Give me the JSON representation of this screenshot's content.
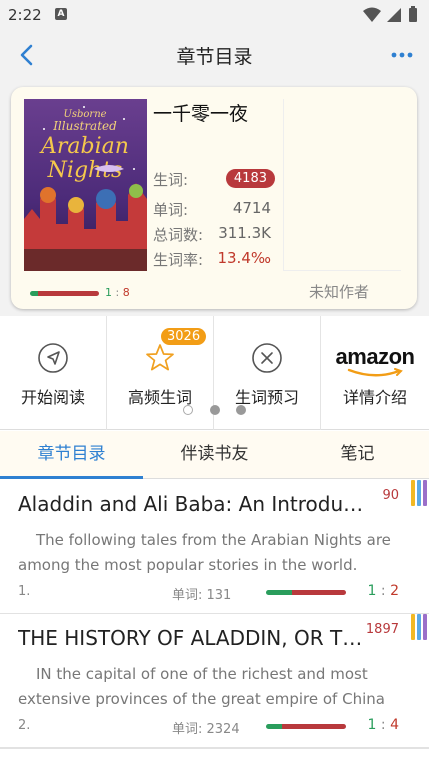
{
  "status_bar": {
    "time": "2:22",
    "notification_icon": "A"
  },
  "header": {
    "title": "章节目录",
    "back_icon": "chevron-left-icon",
    "more_icon": "more-dots-icon",
    "accent": "#2f80d1"
  },
  "book": {
    "title": "一千零一夜",
    "cover": {
      "publisher": "Usborne",
      "series": "Illustrated",
      "line1": "Arabian",
      "line2": "Nights"
    },
    "new_words_label": "生词:",
    "new_words_value": "4183",
    "words_label": "单词:",
    "words_value": "4714",
    "total_words_label": "总词数:",
    "total_words_value": "311.3K",
    "rate_label": "生词率:",
    "rate_value": "13.4‰",
    "author": "未知作者",
    "ratio_left": "1",
    "ratio_sep": " : ",
    "ratio_right": "8",
    "progress_known": 0.11
  },
  "actions": [
    {
      "label": "开始阅读",
      "icon": "navigation-arrow-icon"
    },
    {
      "label": "高频生词",
      "icon": "star-icon",
      "badge": "3026"
    },
    {
      "label": "生词预习",
      "icon": "close-circle-icon"
    },
    {
      "label": "详情介绍",
      "icon": "amazon-logo",
      "logo_text": "amazon"
    }
  ],
  "pager": {
    "count": 3,
    "active": 2
  },
  "tabs": [
    {
      "label": "章节目录",
      "active": true
    },
    {
      "label": "伴读书友",
      "active": false
    },
    {
      "label": "笔记",
      "active": false
    }
  ],
  "chapters": [
    {
      "title": "Aladdin and Ali Baba: An Introductory Note",
      "new_words": "90",
      "desc": "The following tales from the Arabian Nights are among the most popular stories in the world.",
      "index": "1.",
      "words": "单词: 131",
      "ratio_left": "1",
      "ratio_right": "2",
      "progress_known": 0.33
    },
    {
      "title": "THE HISTORY OF ALADDIN, OR THE WONDERFUL LAMP",
      "new_words": "1897",
      "desc": "IN the capital of one of the richest and most extensive provinces of the great empire of China there lived a tailor",
      "index": "2.",
      "words": "单词: 2324",
      "ratio_left": "1",
      "ratio_right": "4",
      "progress_known": 0.2
    }
  ],
  "colors": {
    "known": "#2a9d5c",
    "unknown": "#b8393c",
    "badge_orange": "#f29d16",
    "stripe_1": "#f2b824",
    "stripe_2": "#5aa9e6",
    "stripe_3": "#9b6fc9"
  }
}
